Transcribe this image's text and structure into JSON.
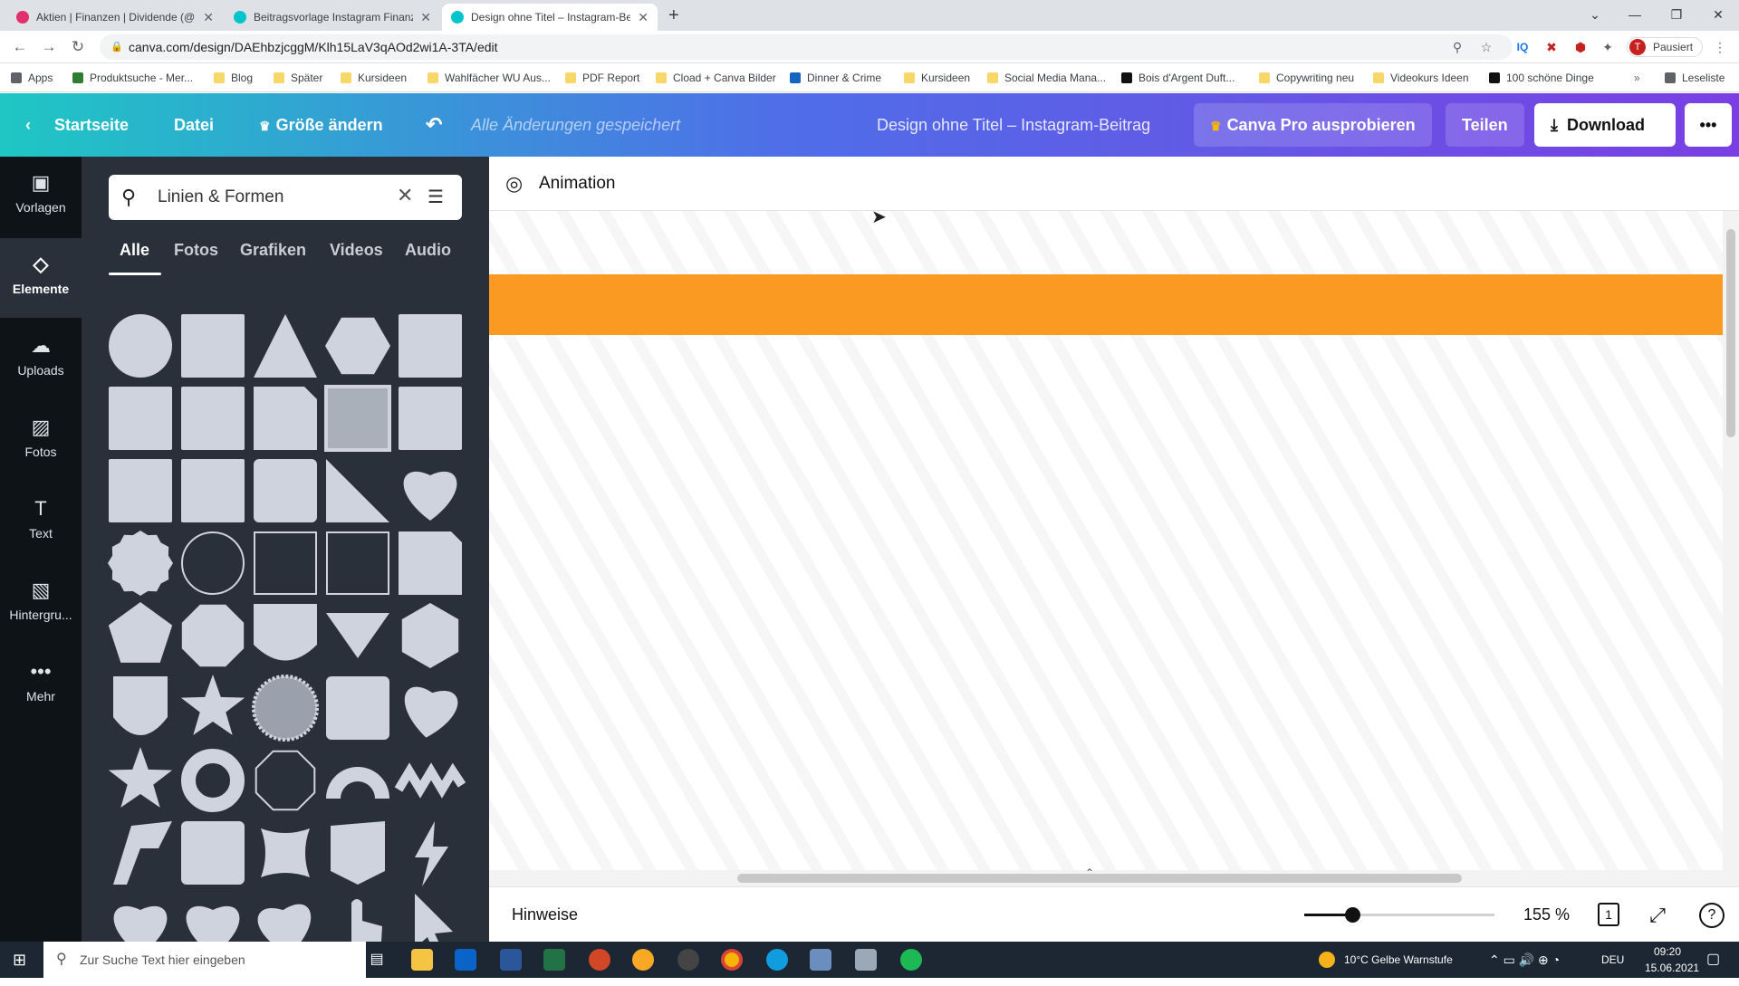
{
  "browser": {
    "tabs": [
      {
        "title": "Aktien | Finanzen | Dividende (@",
        "active": false,
        "favicon_color": "#e1306c"
      },
      {
        "title": "Beitragsvorlage Instagram Finanz",
        "active": false,
        "favicon_color": "#00c4cc"
      },
      {
        "title": "Design ohne Titel – Instagram-Be",
        "active": true,
        "favicon_color": "#00c4cc"
      }
    ],
    "new_tab": "+",
    "url": "canva.com/design/DAEhbzjcggM/Klh15LaV3qAOd2wi1A-3TA/edit",
    "profile_initial": "T",
    "profile_status": "Pausiert",
    "bookmarks": [
      "Apps",
      "Produktsuche - Mer...",
      "Blog",
      "Später",
      "Kursideen",
      "Wahlfächer WU Aus...",
      "PDF Report",
      "Cload + Canva Bilder",
      "Dinner & Crime",
      "Kursideen",
      "Social Media Mana...",
      "Bois d'Argent Duft...",
      "Copywriting neu",
      "Videokurs Ideen",
      "100 schöne Dinge"
    ],
    "reading_list": "Leseliste"
  },
  "header": {
    "home": "Startseite",
    "file": "Datei",
    "resize": "Größe ändern",
    "saved_status": "Alle Änderungen gespeichert",
    "doc_title": "Design ohne Titel – Instagram-Beitrag",
    "pro": "Canva Pro ausprobieren",
    "share": "Teilen",
    "download": "Download",
    "more": "•••"
  },
  "rail": [
    {
      "label": "Vorlagen",
      "icon": "templates-icon"
    },
    {
      "label": "Elemente",
      "icon": "elements-icon",
      "selected": true
    },
    {
      "label": "Uploads",
      "icon": "upload-icon"
    },
    {
      "label": "Fotos",
      "icon": "photo-icon"
    },
    {
      "label": "Text",
      "icon": "text-icon"
    },
    {
      "label": "Hintergru...",
      "icon": "background-icon"
    },
    {
      "label": "Mehr",
      "icon": "more-icon"
    }
  ],
  "panel": {
    "search_value": "Linien & Formen",
    "tabs": [
      "Alle",
      "Fotos",
      "Grafiken",
      "Videos",
      "Audio"
    ],
    "active_tab": "Alle",
    "shapes": [
      "circle",
      "square",
      "triangle",
      "hexagon",
      "square",
      "square",
      "square",
      "folded-square",
      "gray-square",
      "square",
      "square",
      "square",
      "rounded-square",
      "right-triangle",
      "heart",
      "scalloped-circle",
      "circle-outline",
      "square-outline",
      "square-outline",
      "cut-corner-square",
      "pentagon",
      "octagon",
      "shield",
      "down-triangle",
      "hexagon-vertical",
      "shield-badge",
      "star",
      "striped-circle",
      "rounded-square",
      "heart-lean",
      "star",
      "ring",
      "octagon-outline",
      "arc",
      "zigzag",
      "bolt-zigzag",
      "rounded-square",
      "wavy-square",
      "shield-pennant",
      "lightning",
      "heart",
      "heart",
      "heart-tilt",
      "hand-pointer",
      "arrow-cursor"
    ]
  },
  "editor": {
    "animation": "Animation",
    "canvas_color_band": "#fb9a23",
    "notes": "Hinweise",
    "zoom": "155 %",
    "zoom_fraction": 0.25,
    "page_count": "1"
  },
  "taskbar": {
    "search_placeholder": "Zur Suche Text hier eingeben",
    "weather": "10°C  Gelbe Warnstufe",
    "lang": "DEU",
    "time": "09:20",
    "date": "15.06.2021"
  }
}
